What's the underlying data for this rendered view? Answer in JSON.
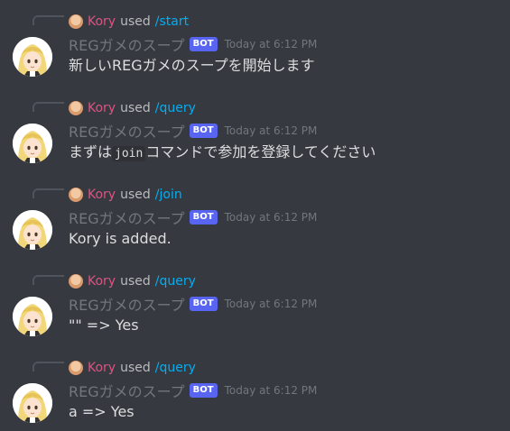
{
  "messages": [
    {
      "command_user": "Kory",
      "command_used": "used",
      "command": "/start",
      "username": "REGガメのスープ",
      "bot_tag": "BOT",
      "timestamp": "Today at 6:12 PM",
      "content": "新しいREGガメのスープを開始します"
    },
    {
      "command_user": "Kory",
      "command_used": "used",
      "command": "/query",
      "username": "REGガメのスープ",
      "bot_tag": "BOT",
      "timestamp": "Today at 6:12 PM",
      "content_before": "まずは",
      "content_code": "join",
      "content_after": "コマンドで参加を登録してください"
    },
    {
      "command_user": "Kory",
      "command_used": "used",
      "command": "/join",
      "username": "REGガメのスープ",
      "bot_tag": "BOT",
      "timestamp": "Today at 6:12 PM",
      "content": "Kory is added."
    },
    {
      "command_user": "Kory",
      "command_used": "used",
      "command": "/query",
      "username": "REGガメのスープ",
      "bot_tag": "BOT",
      "timestamp": "Today at 6:12 PM",
      "content": "\"\" => Yes"
    },
    {
      "command_user": "Kory",
      "command_used": "used",
      "command": "/query",
      "username": "REGガメのスープ",
      "bot_tag": "BOT",
      "timestamp": "Today at 6:12 PM",
      "content": "a => Yes"
    }
  ],
  "colors": {
    "background": "#36393f",
    "command_user": "#e05284",
    "command_link": "#00aff4",
    "username": "#72767d",
    "bot_tag": "#5865f2",
    "message_text": "#dcddde"
  },
  "icons": {
    "avatar": "blonde-anime-girl-avatar",
    "mini_avatar": "user-mini-avatar-icon"
  }
}
